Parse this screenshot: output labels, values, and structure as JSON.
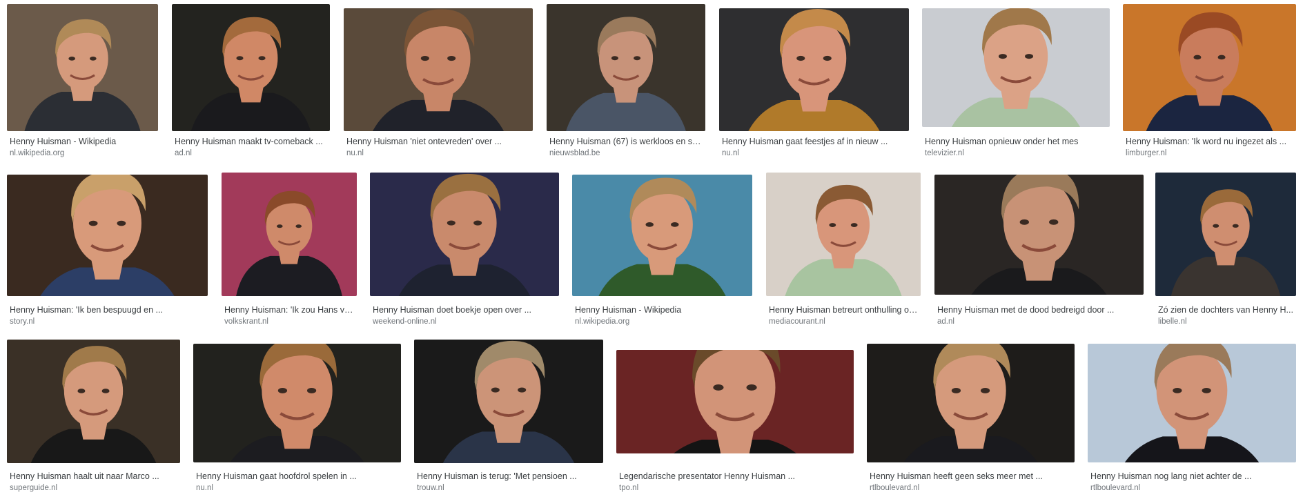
{
  "results": [
    {
      "title": "Henny Huisman - Wikipedia",
      "source": "nl.wikipedia.org",
      "bg": "#6b5a4a",
      "shirt": "#2b2e34",
      "hair": "#b08a58",
      "skin": "#d59a7c"
    },
    {
      "title": "Henny Huisman maakt tv-comeback ...",
      "source": "ad.nl",
      "bg": "#23231f",
      "shirt": "#1a1a1d",
      "hair": "#a36a3c",
      "skin": "#d08866"
    },
    {
      "title": "Henny Huisman 'niet ontevreden' over ...",
      "source": "nu.nl",
      "bg": "#5a4a3a",
      "shirt": "#20222a",
      "hair": "#7a5436",
      "skin": "#c88668"
    },
    {
      "title": "Henny Huisman (67) is werkloos en sn...",
      "source": "nieuwsblad.be",
      "bg": "#3a342c",
      "shirt": "#4a5566",
      "hair": "#9a7a5c",
      "skin": "#c8937a"
    },
    {
      "title": "Henny Huisman gaat feestjes af in nieuw ...",
      "source": "nu.nl",
      "bg": "#2e2e30",
      "shirt": "#b07a2a",
      "hair": "#c48a4a",
      "skin": "#d8957a"
    },
    {
      "title": "Henny Huisman opnieuw onder het mes",
      "source": "televizier.nl",
      "bg": "#c9ccd1",
      "shirt": "#a9c2a2",
      "hair": "#a0784a",
      "skin": "#dba286"
    },
    {
      "title": "Henny Huisman: 'Ik word nu ingezet als ...",
      "source": "limburger.nl",
      "bg": "#c9762a",
      "shirt": "#1b2540",
      "hair": "#9a4a24",
      "skin": "#c97c5c"
    },
    {
      "title": "Henny Huisman: 'Ik ben bespuugd en ...",
      "source": "story.nl",
      "bg": "#3a2a20",
      "shirt": "#2c3e66",
      "hair": "#c9a06a",
      "skin": "#d89a7a"
    },
    {
      "title": "Henny Huisman: 'Ik zou Hans va...",
      "source": "volkskrant.nl",
      "bg": "#a23a5a",
      "shirt": "#1c1c22",
      "hair": "#8a4a2a",
      "skin": "#cf8a6a"
    },
    {
      "title": "Henny Huisman doet boekje open over ...",
      "source": "weekend-online.nl",
      "bg": "#2a2a4a",
      "shirt": "#1e2230",
      "hair": "#9a7040",
      "skin": "#c98a6c"
    },
    {
      "title": "Henny Huisman - Wikipedia",
      "source": "nl.wikipedia.org",
      "bg": "#4a8aa8",
      "shirt": "#2f5a2a",
      "hair": "#b08a5a",
      "skin": "#d89a7a"
    },
    {
      "title": "Henny Huisman betreurt onthulling ov...",
      "source": "mediacourant.nl",
      "bg": "#d8d0c8",
      "shirt": "#a8c4a0",
      "hair": "#8a5a34",
      "skin": "#d8967a"
    },
    {
      "title": "Henny Huisman met de dood bedreigd door ...",
      "source": "ad.nl",
      "bg": "#2a2624",
      "shirt": "#1a1a1c",
      "hair": "#9a7a5a",
      "skin": "#c89276"
    },
    {
      "title": "Zó zien de dochters van Henny H...",
      "source": "libelle.nl",
      "bg": "#1e2a3a",
      "shirt": "#3a3430",
      "hair": "#9a6a3a",
      "skin": "#cf8e70"
    },
    {
      "title": "Henny Huisman haalt uit naar Marco ...",
      "source": "superguide.nl",
      "bg": "#3a3026",
      "shirt": "#181818",
      "hair": "#a07a4a",
      "skin": "#d59a7c"
    },
    {
      "title": "Henny Huisman gaat hoofdrol spelen in ...",
      "source": "nu.nl",
      "bg": "#22221e",
      "shirt": "#1c1c20",
      "hair": "#9a6a3a",
      "skin": "#d08a6a"
    },
    {
      "title": "Henny Huisman is terug: 'Met pensioen ...",
      "source": "trouw.nl",
      "bg": "#1a1a1a",
      "shirt": "#2a3448",
      "hair": "#a08a6a",
      "skin": "#cc9478"
    },
    {
      "title": "Legendarische presentator Henny Huisman ...",
      "source": "tpo.nl",
      "bg": "#6a2424",
      "shirt": "#141414",
      "hair": "#6a4a2a",
      "skin": "#d29478"
    },
    {
      "title": "Henny Huisman heeft geen seks meer met ...",
      "source": "rtlboulevard.nl",
      "bg": "#1e1c1a",
      "shirt": "#1a1a1e",
      "hair": "#b08a5a",
      "skin": "#d59a7c"
    },
    {
      "title": "Henny Huisman nog lang niet achter de ...",
      "source": "rtlboulevard.nl",
      "bg": "#b8c8d8",
      "shirt": "#15151a",
      "hair": "#9a7a5a",
      "skin": "#d29478"
    }
  ]
}
